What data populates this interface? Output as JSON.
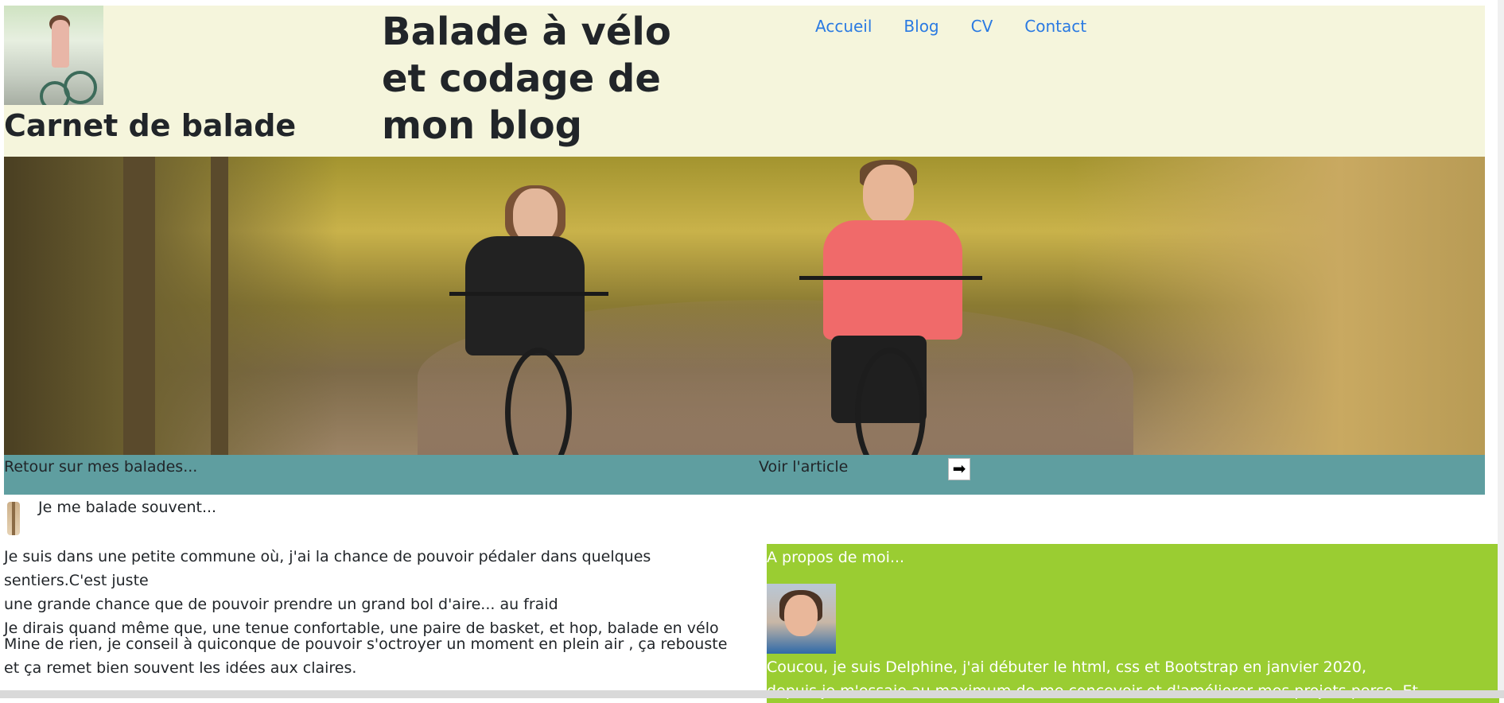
{
  "header": {
    "site_name": "Carnet de balade",
    "page_title": "Balade à vélo et codage de mon blog",
    "nav": [
      "Accueil",
      "Blog",
      "CV",
      "Contact"
    ]
  },
  "banner": {
    "back_text": "Retour sur mes balades...",
    "view_article": "Voir l'article",
    "arrow_glyph": "➡"
  },
  "article": {
    "heading": "Je me balade souvent...",
    "paragraph1_line1": "Je suis dans une petite commune où, j'ai la chance de pouvoir pédaler dans quelques sentiers.C'est juste",
    "paragraph1_line2": "une grande chance que de pouvoir prendre un grand bol d'aire... au fraid",
    "paragraph1_line3": "Je dirais quand même que, une tenue confortable, une paire de basket, et hop, balade en vélo",
    "paragraph2_line1": "Mine de rien, je conseil à quiconque de pouvoir s'octroyer un moment en plein air , ça rebouste",
    "paragraph2_line2": "et ça remet bien souvent les idées aux claires."
  },
  "about": {
    "title": "A propos de moi...",
    "text_line1": "Coucou, je suis Delphine, j'ai débuter le html, css et Bootstrap en janvier 2020,",
    "text_line2": "depuis je m'essaie au maximum de me concevoir et d'améliorer mes projets perso. Et"
  },
  "colors": {
    "header_bg": "#f5f5dc",
    "nav_link": "#2a7ae2",
    "banner_bg": "#5f9ea0",
    "about_bg": "#9acd32"
  }
}
